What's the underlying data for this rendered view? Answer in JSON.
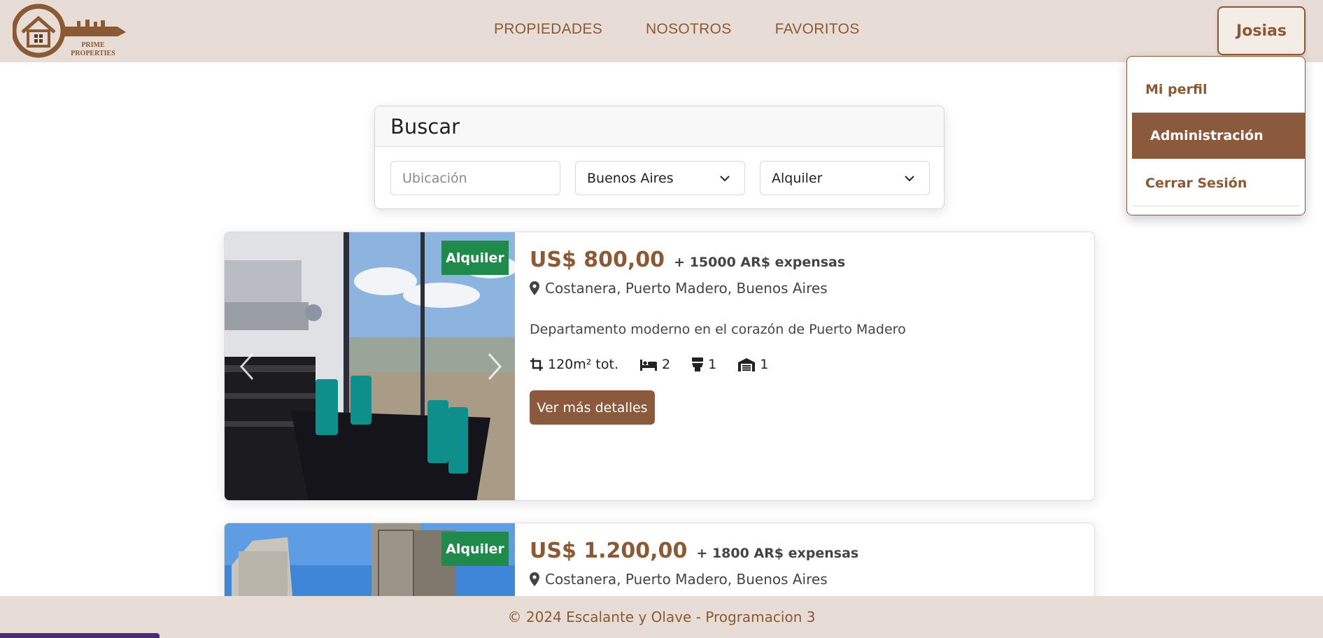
{
  "brand": {
    "line1": "PRIME",
    "line2": "PROPERTIES"
  },
  "nav": {
    "items": [
      "PROPIEDADES",
      "NOSOTROS",
      "FAVORITOS"
    ]
  },
  "user": {
    "name": "Josias",
    "menu": [
      "Mi perfil",
      "Administración",
      "Cerrar Sesión"
    ]
  },
  "search": {
    "title": "Buscar",
    "location_placeholder": "Ubicación",
    "province": "Buenos Aires",
    "operation": "Alquiler"
  },
  "listings": [
    {
      "badge": "Alquiler",
      "price": "US$ 800,00",
      "expenses": "+ 15000 AR$ expensas",
      "location": "Costanera, Puerto Madero, Buenos Aires",
      "description": "Departamento moderno en el corazón de Puerto Madero",
      "area": "120m² tot.",
      "bedrooms": "2",
      "bathrooms": "1",
      "garages": "1",
      "button": "Ver más detalles"
    },
    {
      "badge": "Alquiler",
      "price": "US$ 1.200,00",
      "expenses": "+ 1800 AR$ expensas",
      "location": "Costanera, Puerto Madero, Buenos Aires"
    }
  ],
  "footer": {
    "text": "© 2024 Escalante y Olave - Programacion 3"
  },
  "colors": {
    "brand": "#8b5a34",
    "nav_bg": "#e8ddd6",
    "badge": "#1f8a4c"
  }
}
